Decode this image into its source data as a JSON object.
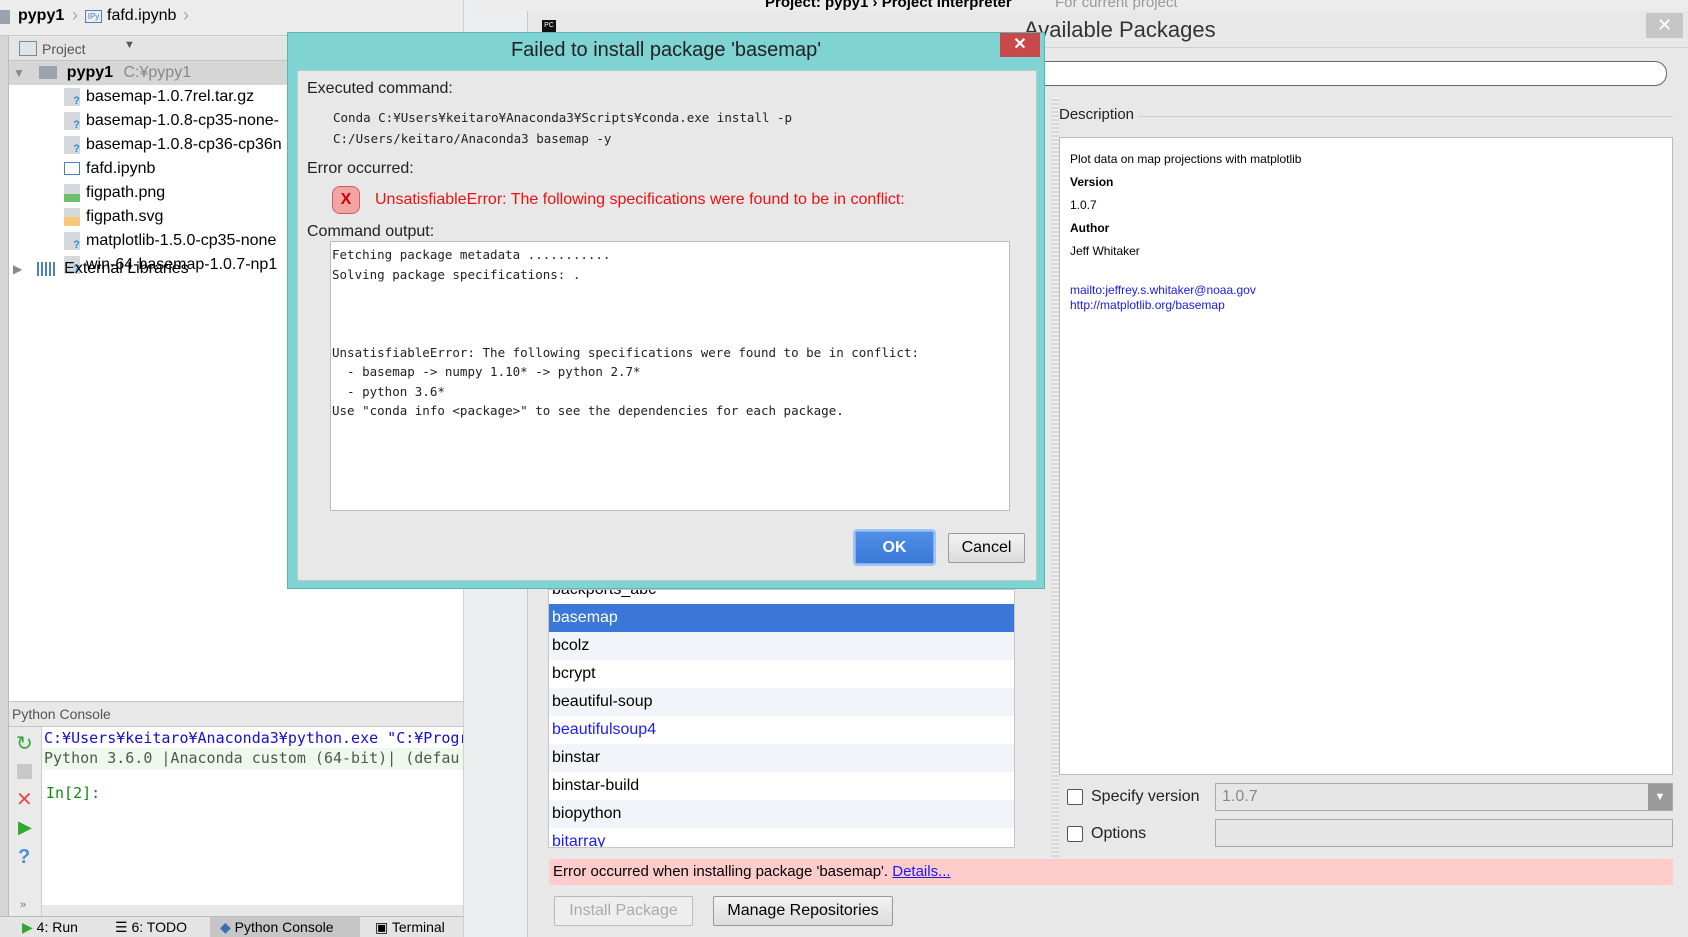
{
  "breadcrumb": {
    "project": "pypy1",
    "file": "fafd.ipynb"
  },
  "project_panel": {
    "title": "Project",
    "root": {
      "name": "pypy1",
      "path": "C:¥pypy1"
    },
    "files": [
      {
        "name": "basemap-1.0.7rel.tar.gz",
        "icon": "unknown-file-icon"
      },
      {
        "name": "basemap-1.0.8-cp35-none-",
        "icon": "unknown-file-icon"
      },
      {
        "name": "basemap-1.0.8-cp36-cp36n",
        "icon": "unknown-file-icon"
      },
      {
        "name": "fafd.ipynb",
        "icon": "ipynb-file-icon"
      },
      {
        "name": "figpath.png",
        "icon": "image-file-icon"
      },
      {
        "name": "figpath.svg",
        "icon": "svg-file-icon"
      },
      {
        "name": "matplotlib-1.5.0-cp35-none",
        "icon": "unknown-file-icon"
      },
      {
        "name": "win-64-basemap-1.0.7-np1",
        "icon": "unknown-file-icon"
      }
    ],
    "external": "External Libraries"
  },
  "console": {
    "title": "Python Console",
    "lines": [
      "C:¥Users¥keitaro¥Anaconda3¥python.exe \"C:¥Program Fi",
      "Python 3.6.0 |Anaconda custom (64-bit)| (defau"
    ],
    "prompt": "In[2]:"
  },
  "bottom_tabs": [
    "4: Run",
    "6: TODO",
    "Python Console",
    "Terminal"
  ],
  "settings": {
    "breadcrumb": "Project: pypy1 › Project Interpreter",
    "scope": "For current project"
  },
  "available_packages": {
    "title": "Available Packages",
    "search_value": "",
    "packages": [
      {
        "name": "backports_abc"
      },
      {
        "name": "basemap",
        "selected": true
      },
      {
        "name": "bcolz"
      },
      {
        "name": "bcrypt"
      },
      {
        "name": "beautiful-soup"
      },
      {
        "name": "beautifulsoup4",
        "installed": true
      },
      {
        "name": "binstar"
      },
      {
        "name": "binstar-build"
      },
      {
        "name": "biopython"
      },
      {
        "name": "bitarray",
        "installed": true
      }
    ],
    "description": {
      "label": "Description",
      "summary": "Plot data on map projections with matplotlib",
      "version_label": "Version",
      "version": "1.0.7",
      "author_label": "Author",
      "author": "Jeff Whitaker",
      "links": [
        "mailto:jeffrey.s.whitaker@noaa.gov",
        "http://matplotlib.org/basemap"
      ]
    },
    "specify_version": {
      "label": "Specify version",
      "checked": false,
      "value": "1.0.7"
    },
    "options": {
      "label": "Options",
      "checked": false,
      "value": ""
    },
    "error_bar": {
      "text": "Error occurred when installing package 'basemap'. ",
      "link": "Details..."
    },
    "install_button": "Install Package",
    "manage_button": "Manage Repositories"
  },
  "error_dialog": {
    "title": "Failed to install package 'basemap'",
    "executed_label": "Executed command:",
    "command": [
      "Conda C:¥Users¥keitaro¥Anaconda3¥Scripts¥conda.exe install -p",
      "C:/Users/keitaro/Anaconda3 basemap -y"
    ],
    "error_label": "Error occurred:",
    "error_message": "UnsatisfiableError: The following specifications were found to be in conflict:",
    "output_label": "Command output:",
    "output": [
      "Fetching package metadata ...........",
      "Solving package specifications: .",
      "",
      "",
      "",
      "UnsatisfiableError: The following specifications were found to be in conflict:",
      "  - basemap -> numpy 1.10* -> python 2.7*",
      "  - python 3.6*",
      "Use \"conda info <package>\" to see the dependencies for each package."
    ],
    "ok": "OK",
    "cancel": "Cancel"
  },
  "colors": {
    "dialog_frame": "#7fd3d3",
    "close_red": "#c9494a",
    "selection": "#3a77d8",
    "error_text": "#ee1111",
    "error_bar": "#ffcccc",
    "installed_blue": "#1b1bff"
  }
}
